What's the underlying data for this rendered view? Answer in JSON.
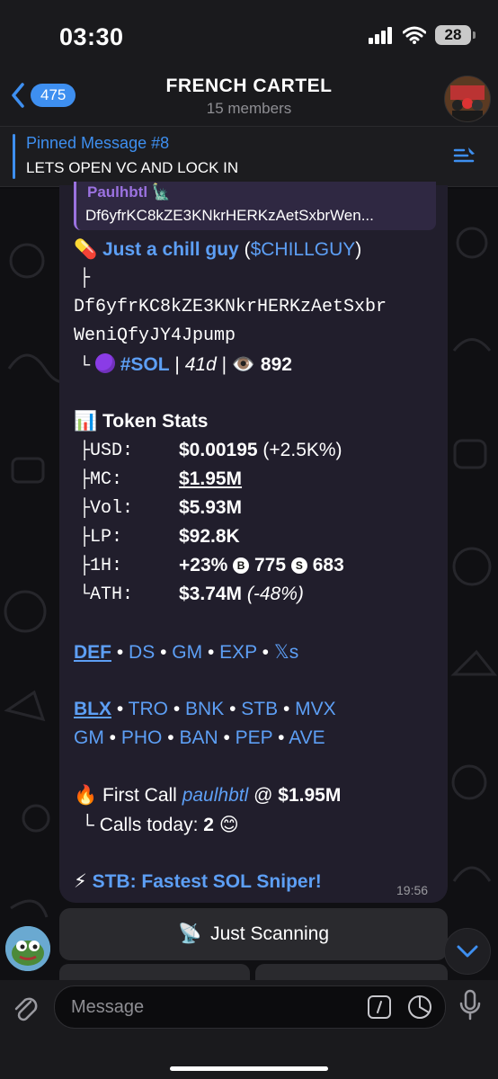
{
  "status_bar": {
    "time": "03:30",
    "battery": "28"
  },
  "header": {
    "back_count": "475",
    "title": "FRENCH CARTEL",
    "subtitle": "15 members"
  },
  "pinned": {
    "title": "Pinned Message #8",
    "text": "LETS OPEN VC AND LOCK IN"
  },
  "message": {
    "reply_name": "Paulhbtl",
    "reply_emoji": "🗽",
    "reply_text": "Df6yfrKC8kZE3KNkrHERKzAetSxbrWen...",
    "pill_emoji": "💊",
    "token_name": "Just a chill guy",
    "ticker_open": "(",
    "ticker": "$CHILLGUY",
    "ticker_close": ")",
    "tree_branch": "├",
    "address_line1": "Df6yfrKC8kZE3KNkrHERKzAetSxbr",
    "address_line2": "WeniQfyJY4Jpump",
    "tree_end": "└",
    "chain_tag": "#SOL",
    "sep": "|",
    "age": "41d",
    "eye_emoji": "👁️",
    "views": "892",
    "stats_emoji": "📊",
    "stats_title": "Token Stats",
    "stats": [
      {
        "label": "├USD:",
        "value": "$0.00195",
        "extra": " (+2.5K%)"
      },
      {
        "label": "├MC:",
        "value": "$1.95M",
        "extra": ""
      },
      {
        "label": "├Vol:",
        "value": "$5.93M",
        "extra": ""
      },
      {
        "label": "├LP:",
        "value": "$92.8K",
        "extra": ""
      },
      {
        "label": "├1H:",
        "value": "+23%",
        "b_icon": "B",
        "b_count": "775",
        "s_icon": "S",
        "s_count": "683"
      },
      {
        "label": "└ATH:",
        "value": "$3.74M",
        "extra": " (-48%)"
      }
    ],
    "links1": [
      "DEF",
      "DS",
      "GM",
      "EXP",
      "𝕏s"
    ],
    "links2_row1": [
      "BLX",
      "TRO",
      "BNK",
      "STB",
      "MVX"
    ],
    "links2_row2": [
      "GM",
      "PHO",
      "BAN",
      "PEP",
      "AVE"
    ],
    "bullet": "•",
    "fire_emoji": "🔥",
    "first_call_label": "First Call",
    "first_call_user": "paulhbtl",
    "at": "@",
    "first_call_value": "$1.95M",
    "calls_today_label": "└ Calls today:",
    "calls_today": "2",
    "smile_emoji": "😊",
    "bolt_emoji": "⚡",
    "promo": "STB: Fastest SOL Sniper!",
    "time": "19:56"
  },
  "keyboard": {
    "button_emoji": "📡",
    "button_label": "Just Scanning"
  },
  "input": {
    "placeholder": "Message"
  },
  "colors": {
    "accent": "#3e8ff0",
    "link": "#5d9ff5",
    "bubble": "#211e2c",
    "reply_accent": "#9b72e0"
  }
}
